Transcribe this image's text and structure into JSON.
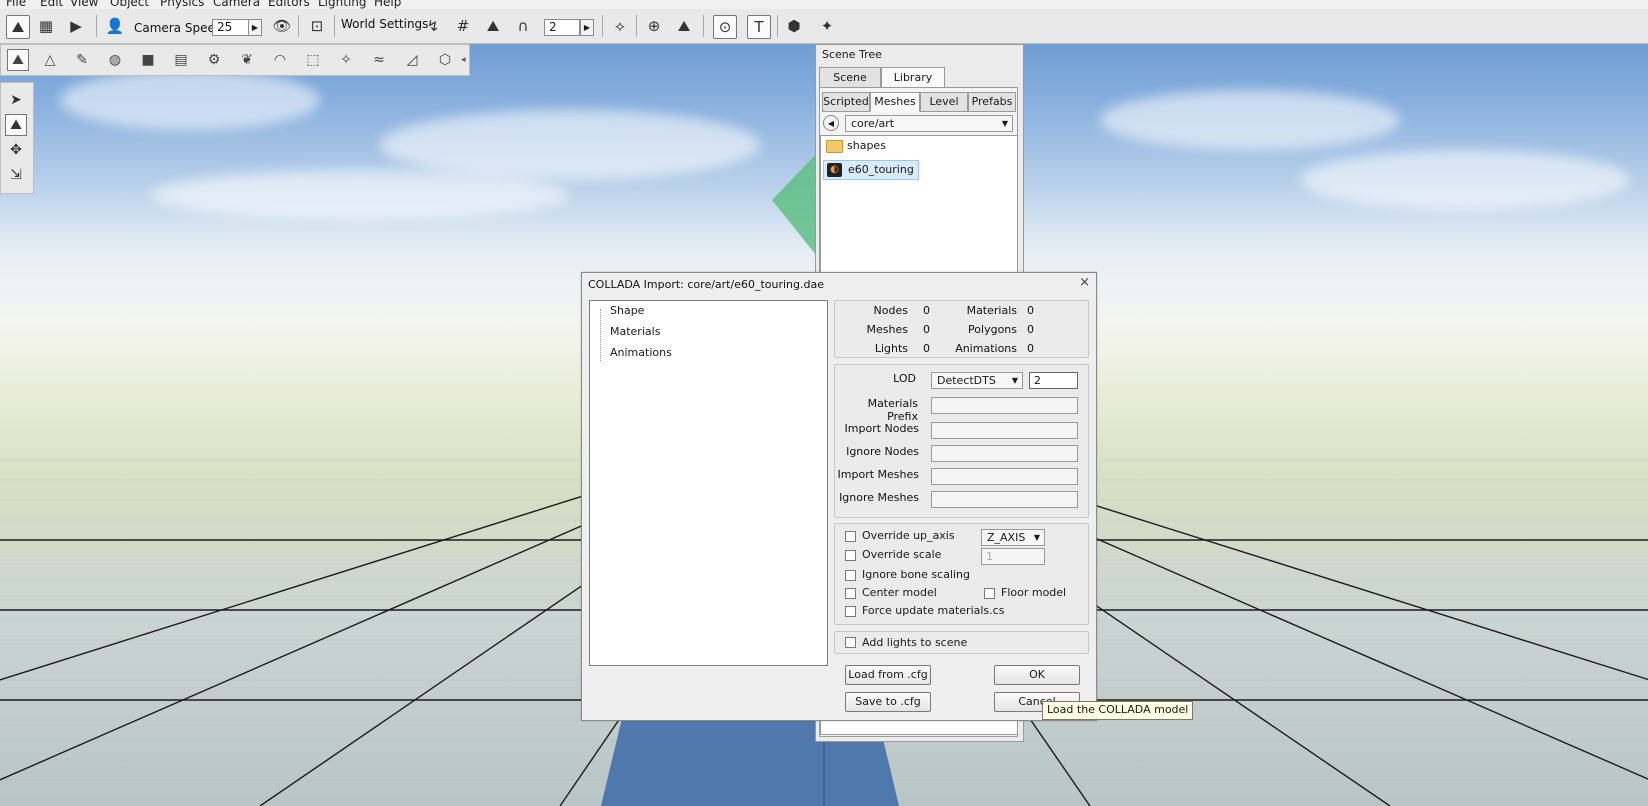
{
  "menu": [
    "File",
    "Edit",
    "View",
    "Object",
    "Physics",
    "Camera",
    "Editors",
    "Lighting",
    "Help"
  ],
  "toolbar": {
    "camera_speed_label": "Camera Speed",
    "camera_speed_value": "25",
    "world_settings_label": "World Settings",
    "snap_value": "2"
  },
  "scene_tree": {
    "title": "Scene Tree",
    "tabs": [
      "Scene",
      "Library"
    ],
    "subtabs": [
      "Scripted",
      "Meshes",
      "Level",
      "Prefabs"
    ],
    "path": "core/art",
    "items": [
      {
        "label": "shapes",
        "icon": "folder-icon"
      },
      {
        "label": "e60_touring",
        "icon": "mesh-icon"
      }
    ]
  },
  "dialog": {
    "title": "COLLADA Import: core/art/e60_touring.dae",
    "tree": [
      "Shape",
      "Materials",
      "Animations"
    ],
    "stats": {
      "nodes_label": "Nodes",
      "nodes": "0",
      "materials_label": "Materials",
      "materials": "0",
      "meshes_label": "Meshes",
      "meshes": "0",
      "polygons_label": "Polygons",
      "polygons": "0",
      "lights_label": "Lights",
      "lights": "0",
      "animations_label": "Animations",
      "animations": "0"
    },
    "lod_label": "LOD",
    "lod_value": "DetectDTS",
    "lod_size": "2",
    "materials_prefix_label": "Materials Prefix",
    "import_nodes_label": "Import Nodes",
    "ignore_nodes_label": "Ignore Nodes",
    "import_meshes_label": "Import Meshes",
    "ignore_meshes_label": "Ignore Meshes",
    "override_up_axis_label": "Override up_axis",
    "up_axis_value": "Z_AXIS",
    "override_scale_label": "Override scale",
    "scale_value": "1",
    "ignore_bone_scaling_label": "Ignore bone scaling",
    "center_model_label": "Center model",
    "floor_model_label": "Floor model",
    "force_update_label": "Force update materials.cs",
    "add_lights_label": "Add lights to scene",
    "load_cfg_label": "Load from .cfg",
    "save_cfg_label": "Save to .cfg",
    "ok_label": "OK",
    "cancel_label": "Cancel",
    "close_glyph": "×"
  },
  "tooltip": "Load the COLLADA model"
}
